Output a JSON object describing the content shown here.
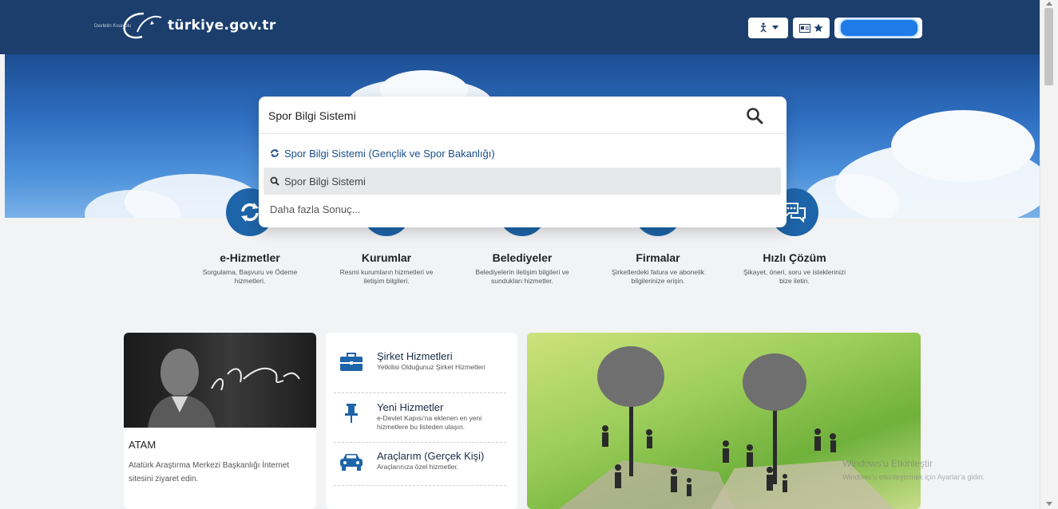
{
  "header": {
    "logo_text": "türkiye.gov.tr",
    "logo_tagline": "Devletin Kısayolu",
    "accessibility_icon": "accessibility-icon",
    "favorites_icons": [
      "id-card-icon",
      "star-icon"
    ],
    "user_button_state": "redacted"
  },
  "search": {
    "value": "Spor Bilgi Sistemi",
    "search_icon": "search-icon",
    "suggestions": [
      {
        "label": "Spor Bilgi Sistemi (Gençlik ve Spor Bakanlığı)",
        "icon": "refresh-icon"
      },
      {
        "label": "Spor Bilgi Sistemi",
        "icon": "search-icon"
      }
    ],
    "more_results": "Daha fazla Sonuç..."
  },
  "services": [
    {
      "name": "e-Hizmetler",
      "desc": "Sorgulama, Başvuru ve Ödeme hizmetleri.",
      "icon": "refresh-icon"
    },
    {
      "name": "Kurumlar",
      "desc": "Resmi kurumların hizmetleri ve iletişim bilgileri.",
      "icon": "building-icon"
    },
    {
      "name": "Belediyeler",
      "desc": "Belediyelerin iletişim bilgileri ve sundukları hizmetler.",
      "icon": "city-icon"
    },
    {
      "name": "Firmalar",
      "desc": "Şirketlerdeki fatura ve abonelik bilgilerinize erişin.",
      "icon": "company-icon"
    },
    {
      "name": "Hızlı Çözüm",
      "desc": "Şikayet, öneri, soru ve isteklerinizi bize iletin.",
      "icon": "chat-icon"
    }
  ],
  "atam_card": {
    "title": "ATAM",
    "desc": "Atatürk Araştırma Merkezi Başkanlığı İnternet sitesini ziyaret edin.",
    "signature": "K. Atatürk"
  },
  "list_card": [
    {
      "title": "Şirket Hizmetleri",
      "desc": "Yetkilisi Olduğunuz Şirket Hizmetleri",
      "icon": "briefcase-icon"
    },
    {
      "title": "Yeni Hizmetler",
      "desc": "e-Devlet Kapısı'na eklenen en yeni hizmetlere bu listeden ulaşın.",
      "icon": "pin-icon"
    },
    {
      "title": "Araçlarım (Gerçek Kişi)",
      "desc": "Araçlarınıza özel hizmetler.",
      "icon": "car-icon"
    }
  ],
  "watermark": {
    "line1": "Windows'u Etkinleştir",
    "line2": "Windows'u etkinleştirmek için Ayarlar'a gidin."
  },
  "colors": {
    "primary": "#1b3e6d",
    "service_circle": "#1e64a8",
    "suggestion_text": "#1b4e8a"
  }
}
